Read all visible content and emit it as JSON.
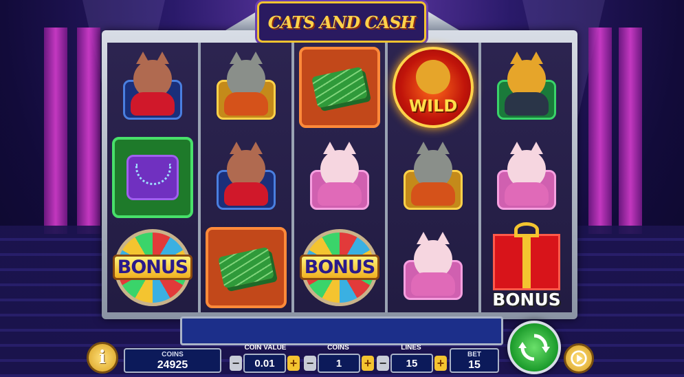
{
  "game": {
    "title": "CATS AND CASH"
  },
  "reels": [
    [
      "lady-cat",
      "jewel-bag",
      "bonus-wheel"
    ],
    [
      "boss-cat",
      "lady-cat",
      "cash-stack"
    ],
    [
      "cash-stack",
      "fluffy-cat",
      "bonus-wheel"
    ],
    [
      "wild-cat",
      "boss-cat",
      "fluffy-cat"
    ],
    [
      "tiger-cat",
      "fluffy-cat",
      "bonus-gift"
    ]
  ],
  "symbol_text": {
    "wild": "WILD",
    "bonus": "BONUS"
  },
  "controls": {
    "info_label": "i",
    "coins_label": "COINS",
    "coins_balance": "24925",
    "coin_value_label": "COIN VALUE",
    "coin_value": "0.01",
    "coins_bet_label": "COINS",
    "coins_bet": "1",
    "lines_label": "LINES",
    "lines": "15",
    "bet_label": "BET",
    "bet": "15",
    "minus": "−",
    "plus": "+"
  },
  "colors": {
    "accent": "#f4c430",
    "spin": "#1a9a2a",
    "panel": "#0c1a5a"
  },
  "icons": {
    "info": "info-icon",
    "spin": "spin-arrows-icon",
    "autoplay": "autoplay-icon"
  }
}
